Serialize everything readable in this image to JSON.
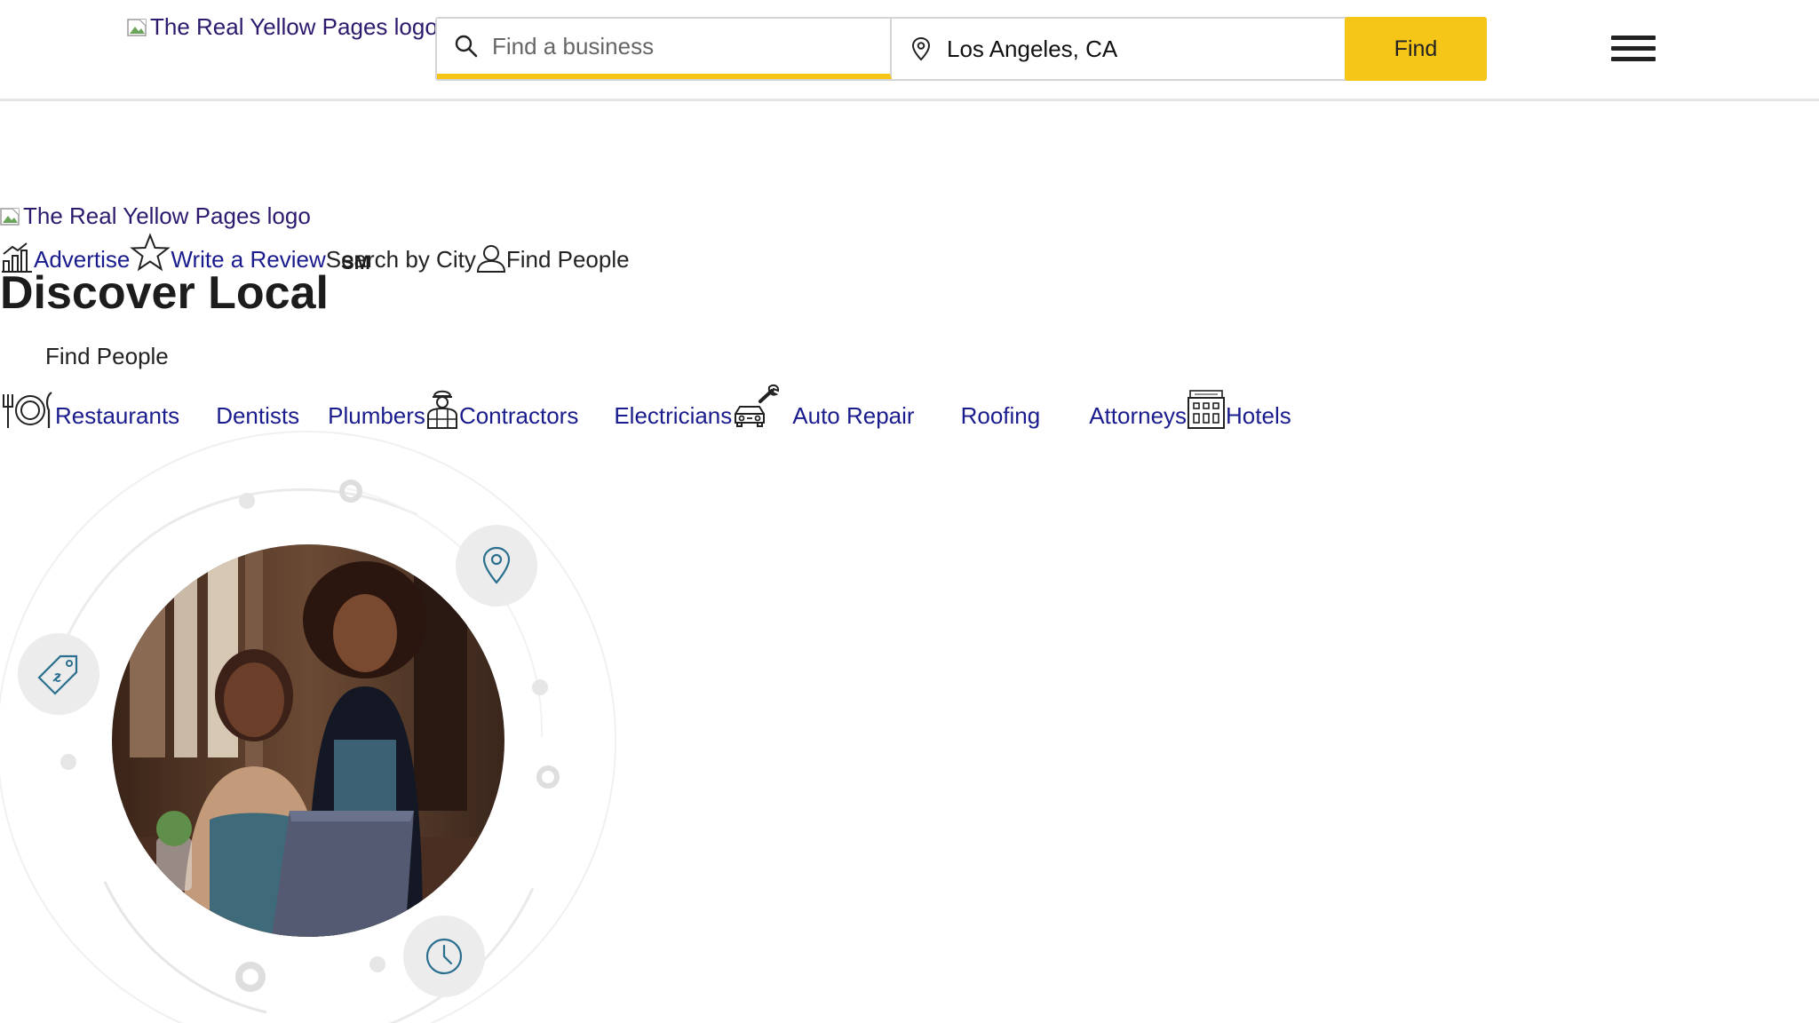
{
  "header": {
    "logo_alt": "The Real Yellow Pages logo",
    "search": {
      "what_placeholder": "Find a business",
      "where_value": "Los Angeles, CA",
      "find_label": "Find"
    }
  },
  "subnav": {
    "logo_alt": "The Real Yellow Pages logo",
    "items": [
      {
        "label": "Advertise",
        "icon": "chart-icon"
      },
      {
        "label": "Write a Review",
        "icon": "star-icon"
      },
      {
        "label": "Search by City"
      },
      {
        "label": "Find People",
        "icon": "person-icon"
      }
    ]
  },
  "hero": {
    "title": "Discover Local",
    "trademark": "SM",
    "find_people": "Find People",
    "categories": [
      {
        "label": "Restaurants",
        "icon": "utensils-icon"
      },
      {
        "label": "Dentists"
      },
      {
        "label": "Plumbers"
      },
      {
        "label": "Contractors",
        "icon": "worker-icon"
      },
      {
        "label": "Electricians"
      },
      {
        "label": "Auto Repair",
        "icon": "car-wrench-icon"
      },
      {
        "label": "Roofing"
      },
      {
        "label": "Attorneys"
      },
      {
        "label": "Hotels",
        "icon": "hotel-icon"
      }
    ]
  },
  "colors": {
    "accent": "#f5c518",
    "link": "#1a1c8e",
    "icon_blue": "#2a6f8f"
  }
}
